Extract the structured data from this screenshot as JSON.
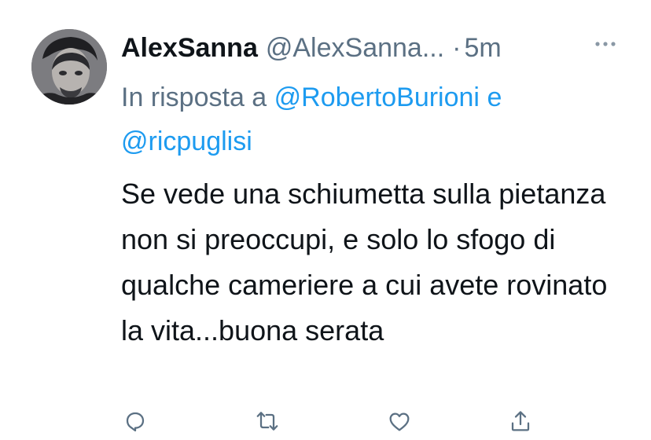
{
  "tweet": {
    "author_name": "AlexSanna",
    "author_handle": "@AlexSanna...",
    "separator": "·",
    "time": "5m",
    "more_icon": "more-dots-icon",
    "reply_prefix": "In risposta a",
    "reply_mention_1": "@RobertoBurioni",
    "reply_join": "e",
    "reply_mention_2": "@ricpuglisi",
    "text": "Se vede una schiumetta sulla pietanza non si preoccupi, e solo lo sfogo di qualche cameriere a cui avete rovinato la vita...buona serata"
  },
  "actions": [
    {
      "icon": "reply-icon"
    },
    {
      "icon": "retweet-icon"
    },
    {
      "icon": "like-icon"
    },
    {
      "icon": "share-icon"
    }
  ],
  "colors": {
    "accent": "#1d9bf0",
    "secondary_text": "#5b7083",
    "primary_text": "#0f1419"
  }
}
